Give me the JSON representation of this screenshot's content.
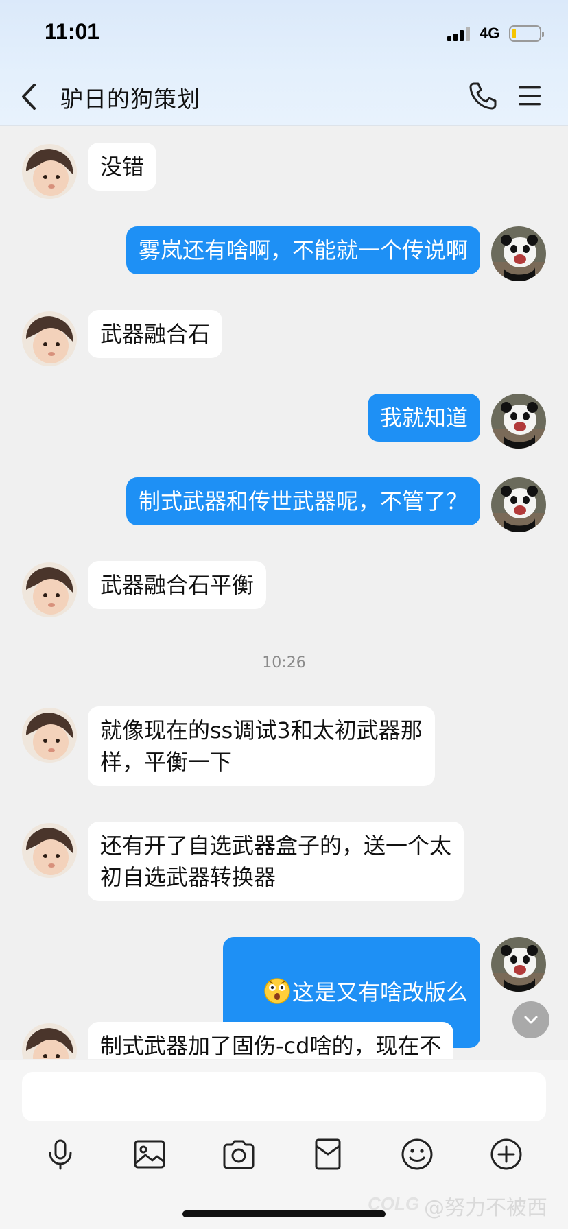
{
  "status_bar": {
    "time": "11:01",
    "network": "4G"
  },
  "header": {
    "title": "驴日的狗策划"
  },
  "messages": [
    {
      "dir": "in",
      "text": "没错"
    },
    {
      "dir": "out",
      "text": "雾岚还有啥啊，不能就一个传说啊"
    },
    {
      "dir": "in",
      "text": "武器融合石"
    },
    {
      "dir": "out",
      "text": "我就知道"
    },
    {
      "dir": "out",
      "text": "制式武器和传世武器呢，不管了？"
    },
    {
      "dir": "in",
      "text": "武器融合石平衡"
    },
    {
      "timestamp": "10:26"
    },
    {
      "dir": "in",
      "text": "就像现在的ss调试3和太初武器那\n样，平衡一下"
    },
    {
      "dir": "in",
      "text": "还有开了自选武器盒子的，送一个太\n初自选武器转换器"
    },
    {
      "dir": "out",
      "text": "这是又有啥改版么",
      "emoji": "astonished-face"
    },
    {
      "dir": "in",
      "text": "制式武器加了固伤-cd啥的，现在不"
    }
  ],
  "input": {
    "placeholder": ""
  },
  "toolbar": [
    "microphone-icon",
    "image-icon",
    "camera-icon",
    "red-packet-icon",
    "emoji-icon",
    "plus-icon"
  ],
  "watermark": {
    "logo": "COLG",
    "text": "@努力不被西"
  },
  "colors": {
    "outgoing_bubble": "#1e90f5",
    "incoming_bubble": "#ffffff",
    "background": "#f0f0f0"
  }
}
